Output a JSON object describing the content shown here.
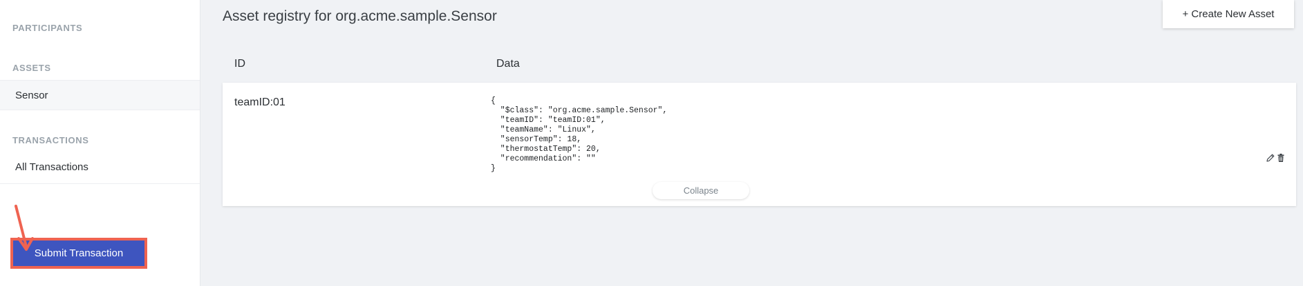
{
  "sidebar": {
    "participants_heading": "PARTICIPANTS",
    "assets_heading": "ASSETS",
    "asset_items": [
      {
        "label": "Sensor",
        "selected": true
      }
    ],
    "transactions_heading": "TRANSACTIONS",
    "transaction_items": [
      {
        "label": "All Transactions"
      }
    ],
    "submit_label": "Submit Transaction"
  },
  "main": {
    "title": "Asset registry for org.acme.sample.Sensor",
    "create_label": "+ Create New Asset",
    "columns": {
      "id": "ID",
      "data": "Data"
    },
    "asset": {
      "id": "teamID:01",
      "json": "{\n  \"$class\": \"org.acme.sample.Sensor\",\n  \"teamID\": \"teamID:01\",\n  \"teamName\": \"Linux\",\n  \"sensorTemp\": 18,\n  \"thermostatTemp\": 20,\n  \"recommendation\": \"\"\n}",
      "collapse_label": "Collapse"
    }
  },
  "colors": {
    "primary_button": "#3e55bf",
    "annotation": "#ef6351",
    "background": "#f0f2f5"
  },
  "icons": {
    "edit": "pencil-icon",
    "delete": "trash-icon"
  }
}
